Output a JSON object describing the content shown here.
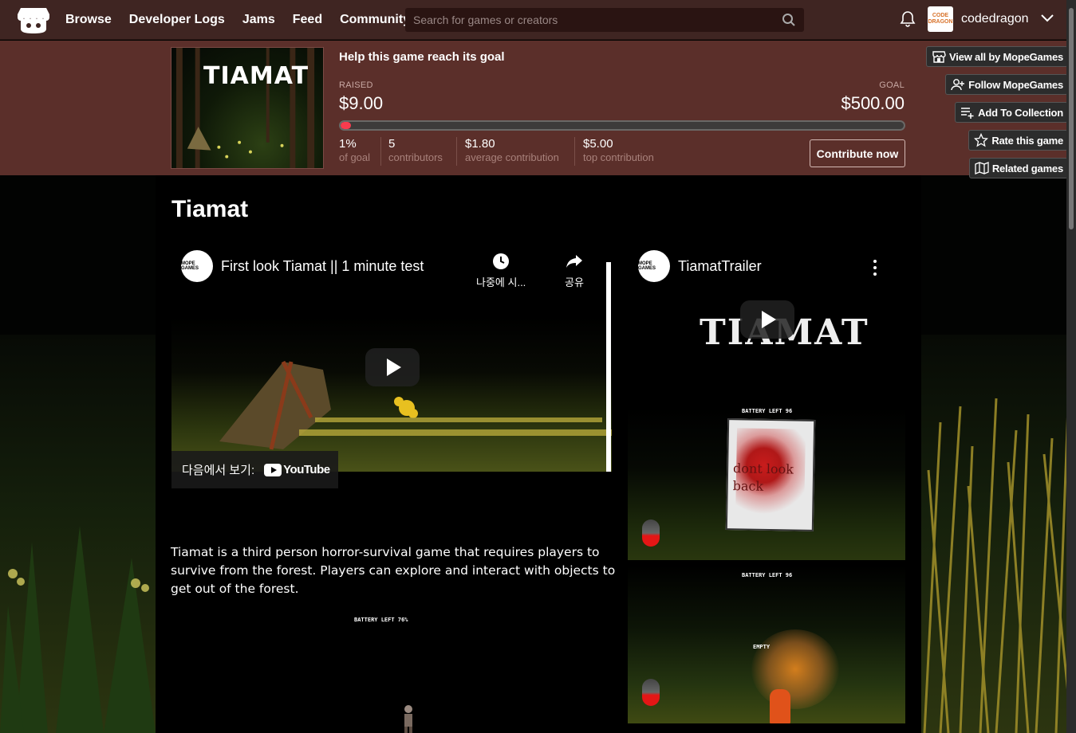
{
  "nav": {
    "links": [
      "Browse",
      "Developer Logs",
      "Jams",
      "Feed",
      "Community"
    ],
    "search_placeholder": "Search for games or creators",
    "username": "codedragon",
    "avatar_text": "CODE DRAGON"
  },
  "fundraiser": {
    "cover_title": "TIAMAT",
    "title": "Help this game reach its goal",
    "raised_label": "RAISED",
    "raised_value": "$9.00",
    "goal_label": "GOAL",
    "goal_value": "$500.00",
    "progress_fraction": 0.018,
    "stats": [
      {
        "value": "1%",
        "label": "of goal"
      },
      {
        "value": "5",
        "label": "contributors"
      },
      {
        "value": "$1.80",
        "label": "average contribution"
      },
      {
        "value": "$5.00",
        "label": "top contribution"
      }
    ],
    "contribute_label": "Contribute now"
  },
  "side_buttons": [
    {
      "label": "View all by MopeGames",
      "icon": "store-icon"
    },
    {
      "label": "Follow MopeGames",
      "icon": "follow-user-icon"
    },
    {
      "label": "Add To Collection",
      "icon": "add-list-icon"
    },
    {
      "label": "Rate this game",
      "icon": "star-icon"
    },
    {
      "label": "Related games",
      "icon": "map-icon"
    }
  ],
  "game": {
    "title": "Tiamat",
    "description": "Tiamat is a third person horror-survival game that requires players to survive from the forest. Players can explore and interact with objects to get out of the forest."
  },
  "video1": {
    "channel_badge": "MOPE GAMES",
    "title": "First look Tiamat || 1 minute test",
    "watch_later": "나중에 시...",
    "share": "공유",
    "watch_on": "다음에서 보기:",
    "youtube": "YouTube"
  },
  "video2": {
    "channel_badge": "MOPE GAMES",
    "title": "TiamatTrailer",
    "logo_text": "TIAMAT"
  },
  "screenshots": {
    "battery_1": "BATTERY LEFT  76%",
    "battery_2": "BATTERY LEFT  96",
    "battery_3": "BATTERY LEFT  96",
    "sign_text": "dont look back",
    "empty": "EMPTY"
  },
  "colors": {
    "nav_bg": "#3f2522",
    "band_bg": "#5b2f2a",
    "progress_fill": "#fa3b4e"
  }
}
